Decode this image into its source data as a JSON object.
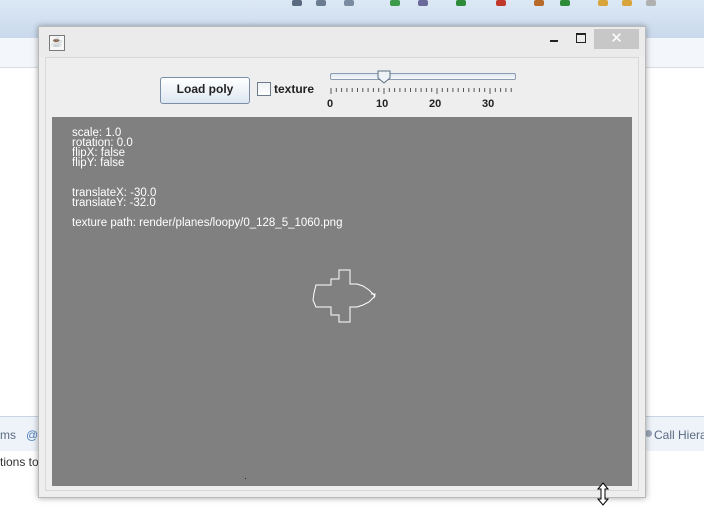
{
  "background_ide": {
    "left_tab_text": "ms",
    "left_body_text": "tions to",
    "right_tab_text": "Call Hiera"
  },
  "window": {
    "close_glyph": "✕"
  },
  "toolbar": {
    "load_button_label": "Load poly",
    "texture_checkbox_label": "texture",
    "texture_checked": false,
    "slider_value": 10,
    "slider_tick_labels": [
      "0",
      "10",
      "20",
      "30"
    ]
  },
  "canvas": {
    "info_lines": [
      "scale: 1.0",
      "rotation: 0.0",
      "flipX: false",
      "flipY: false"
    ],
    "translate_lines": [
      "translateX: -30.0",
      "translateY: -32.0"
    ],
    "texture_path_line": "texture path: render/planes/loopy/0_128_5_1060.png"
  },
  "icons": {
    "java": "java-app-icon",
    "minimize": "minimize-icon",
    "maximize": "maximize-icon",
    "close": "close-icon",
    "cursor": "vertical-resize-cursor-icon"
  }
}
